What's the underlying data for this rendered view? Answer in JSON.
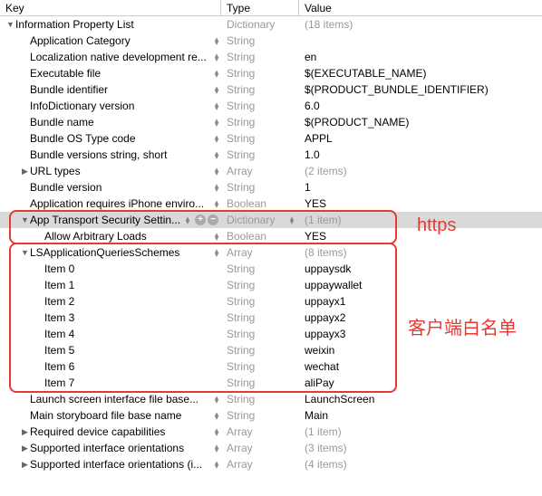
{
  "header": {
    "key": "Key",
    "type": "Type",
    "value": "Value"
  },
  "rows": [
    {
      "indent": 0,
      "disclosure": "down",
      "key": "Information Property List",
      "type": "Dictionary",
      "value": "(18 items)",
      "dim": true,
      "stepper": false,
      "typeStepper": false
    },
    {
      "indent": 1,
      "disclosure": "none",
      "key": "Application Category",
      "type": "String",
      "value": "",
      "dim": false,
      "stepper": true,
      "typeStepper": false
    },
    {
      "indent": 1,
      "disclosure": "none",
      "key": "Localization native development re...",
      "type": "String",
      "value": "en",
      "dim": false,
      "stepper": true,
      "typeStepper": false
    },
    {
      "indent": 1,
      "disclosure": "none",
      "key": "Executable file",
      "type": "String",
      "value": "$(EXECUTABLE_NAME)",
      "dim": false,
      "stepper": true,
      "typeStepper": false
    },
    {
      "indent": 1,
      "disclosure": "none",
      "key": "Bundle identifier",
      "type": "String",
      "value": "$(PRODUCT_BUNDLE_IDENTIFIER)",
      "dim": false,
      "stepper": true,
      "typeStepper": false
    },
    {
      "indent": 1,
      "disclosure": "none",
      "key": "InfoDictionary version",
      "type": "String",
      "value": "6.0",
      "dim": false,
      "stepper": true,
      "typeStepper": false
    },
    {
      "indent": 1,
      "disclosure": "none",
      "key": "Bundle name",
      "type": "String",
      "value": "$(PRODUCT_NAME)",
      "dim": false,
      "stepper": true,
      "typeStepper": false
    },
    {
      "indent": 1,
      "disclosure": "none",
      "key": "Bundle OS Type code",
      "type": "String",
      "value": "APPL",
      "dim": false,
      "stepper": true,
      "typeStepper": false
    },
    {
      "indent": 1,
      "disclosure": "none",
      "key": "Bundle versions string, short",
      "type": "String",
      "value": "1.0",
      "dim": false,
      "stepper": true,
      "typeStepper": false
    },
    {
      "indent": 1,
      "disclosure": "right",
      "key": "URL types",
      "type": "Array",
      "value": "(2 items)",
      "dim": true,
      "stepper": true,
      "typeStepper": false
    },
    {
      "indent": 1,
      "disclosure": "none",
      "key": "Bundle version",
      "type": "String",
      "value": "1",
      "dim": false,
      "stepper": true,
      "typeStepper": false
    },
    {
      "indent": 1,
      "disclosure": "none",
      "key": "Application requires iPhone enviro...",
      "type": "Boolean",
      "value": "YES",
      "dim": false,
      "stepper": true,
      "typeStepper": false
    },
    {
      "indent": 1,
      "disclosure": "down",
      "key": "App Transport Security Settin...",
      "type": "Dictionary",
      "value": "(1 item)",
      "dim": true,
      "stepper": true,
      "selected": true,
      "controls": true,
      "typeStepper": true
    },
    {
      "indent": 2,
      "disclosure": "none",
      "key": "Allow Arbitrary Loads",
      "type": "Boolean",
      "value": "YES",
      "dim": false,
      "stepper": true,
      "typeStepper": false
    },
    {
      "indent": 1,
      "disclosure": "down",
      "key": "LSApplicationQueriesSchemes",
      "type": "Array",
      "value": "(8 items)",
      "dim": true,
      "stepper": true,
      "typeStepper": false
    },
    {
      "indent": 2,
      "disclosure": "none",
      "key": "Item 0",
      "type": "String",
      "value": "uppaysdk",
      "dim": false,
      "stepper": false,
      "typeStepper": false
    },
    {
      "indent": 2,
      "disclosure": "none",
      "key": "Item 1",
      "type": "String",
      "value": "uppaywallet",
      "dim": false,
      "stepper": false,
      "typeStepper": false
    },
    {
      "indent": 2,
      "disclosure": "none",
      "key": "Item 2",
      "type": "String",
      "value": "uppayx1",
      "dim": false,
      "stepper": false,
      "typeStepper": false
    },
    {
      "indent": 2,
      "disclosure": "none",
      "key": "Item 3",
      "type": "String",
      "value": "uppayx2",
      "dim": false,
      "stepper": false,
      "typeStepper": false
    },
    {
      "indent": 2,
      "disclosure": "none",
      "key": "Item 4",
      "type": "String",
      "value": "uppayx3",
      "dim": false,
      "stepper": false,
      "typeStepper": false
    },
    {
      "indent": 2,
      "disclosure": "none",
      "key": "Item 5",
      "type": "String",
      "value": "weixin",
      "dim": false,
      "stepper": false,
      "typeStepper": false
    },
    {
      "indent": 2,
      "disclosure": "none",
      "key": "Item 6",
      "type": "String",
      "value": "wechat",
      "dim": false,
      "stepper": false,
      "typeStepper": false
    },
    {
      "indent": 2,
      "disclosure": "none",
      "key": "Item 7",
      "type": "String",
      "value": "aliPay",
      "dim": false,
      "stepper": false,
      "typeStepper": false
    },
    {
      "indent": 1,
      "disclosure": "none",
      "key": "Launch screen interface file base...",
      "type": "String",
      "value": "LaunchScreen",
      "dim": false,
      "stepper": true,
      "typeStepper": false
    },
    {
      "indent": 1,
      "disclosure": "none",
      "key": "Main storyboard file base name",
      "type": "String",
      "value": "Main",
      "dim": false,
      "stepper": true,
      "typeStepper": false
    },
    {
      "indent": 1,
      "disclosure": "right",
      "key": "Required device capabilities",
      "type": "Array",
      "value": "(1 item)",
      "dim": true,
      "stepper": true,
      "typeStepper": false
    },
    {
      "indent": 1,
      "disclosure": "right",
      "key": "Supported interface orientations",
      "type": "Array",
      "value": "(3 items)",
      "dim": true,
      "stepper": true,
      "typeStepper": false
    },
    {
      "indent": 1,
      "disclosure": "right",
      "key": "Supported interface orientations (i...",
      "type": "Array",
      "value": "(4 items)",
      "dim": true,
      "stepper": true,
      "typeStepper": false
    }
  ],
  "annotations": {
    "label1": "https",
    "label2": "客户端白名单"
  },
  "icons": {
    "plus": "+",
    "minus": "−",
    "up": "▴",
    "down": "▾",
    "right": "▶",
    "downTri": "▼"
  }
}
